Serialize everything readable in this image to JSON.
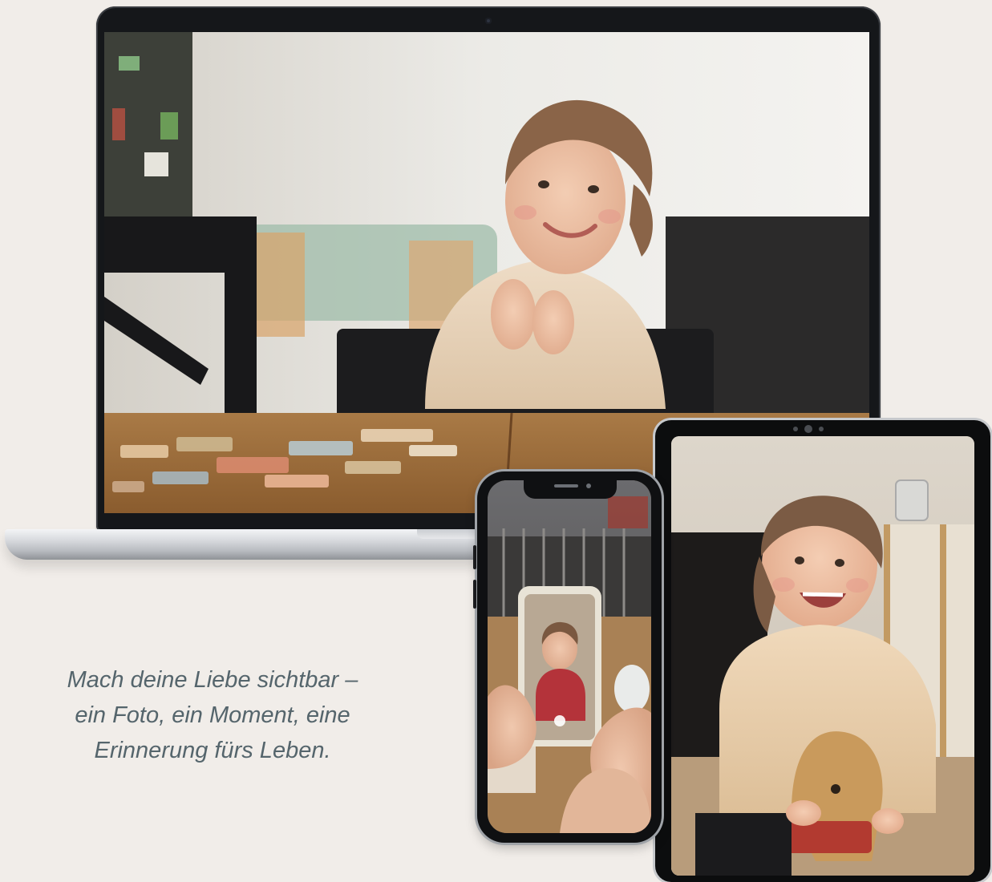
{
  "caption": {
    "line1": "Mach deine Liebe sichtbar –",
    "line2": "ein Foto, ein Moment, eine",
    "line3": "Erinnerung fürs Leben."
  },
  "devices": {
    "laptop": {
      "name": "laptop",
      "photo": "girl-clapping-at-table-with-puzzle"
    },
    "phone": {
      "name": "phone",
      "photo": "hands-photographing-child-with-phone"
    },
    "tablet": {
      "name": "tablet",
      "photo": "girl-smiling-on-rocking-horse"
    }
  },
  "colors": {
    "background": "#f1ede9",
    "caption_text": "#55656c",
    "device_frame": "#15171a"
  }
}
